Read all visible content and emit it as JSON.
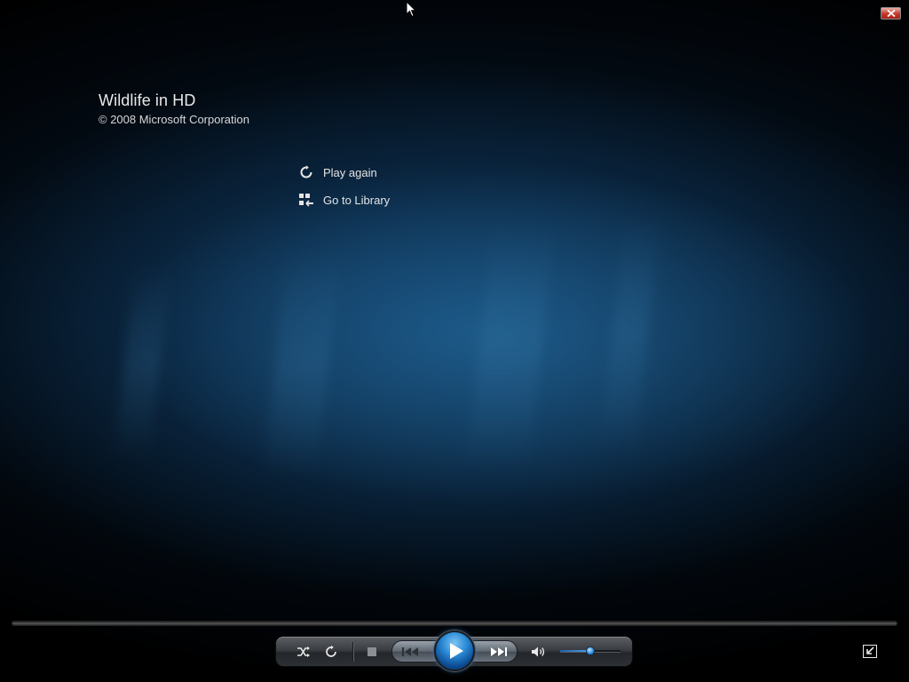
{
  "window": {
    "close_icon": "close-icon"
  },
  "media": {
    "title": "Wildlife in HD",
    "copyright": "© 2008 Microsoft Corporation"
  },
  "actions": {
    "play_again": {
      "label": "Play again",
      "icon": "replay-icon"
    },
    "go_to_library": {
      "label": "Go to Library",
      "icon": "library-icon"
    }
  },
  "seek": {
    "position": 0
  },
  "controls": {
    "shuffle": {
      "icon": "shuffle-icon"
    },
    "repeat": {
      "icon": "repeat-icon"
    },
    "stop": {
      "icon": "stop-icon"
    },
    "previous": {
      "icon": "previous-icon"
    },
    "play": {
      "icon": "play-icon"
    },
    "next": {
      "icon": "next-icon"
    },
    "mute": {
      "icon": "speaker-icon"
    },
    "volume": {
      "level": 0.5
    },
    "fullscreen": {
      "icon": "exit-fullscreen-icon"
    }
  },
  "colors": {
    "accent": "#2a8ad6",
    "close_red": "#c4382a"
  }
}
